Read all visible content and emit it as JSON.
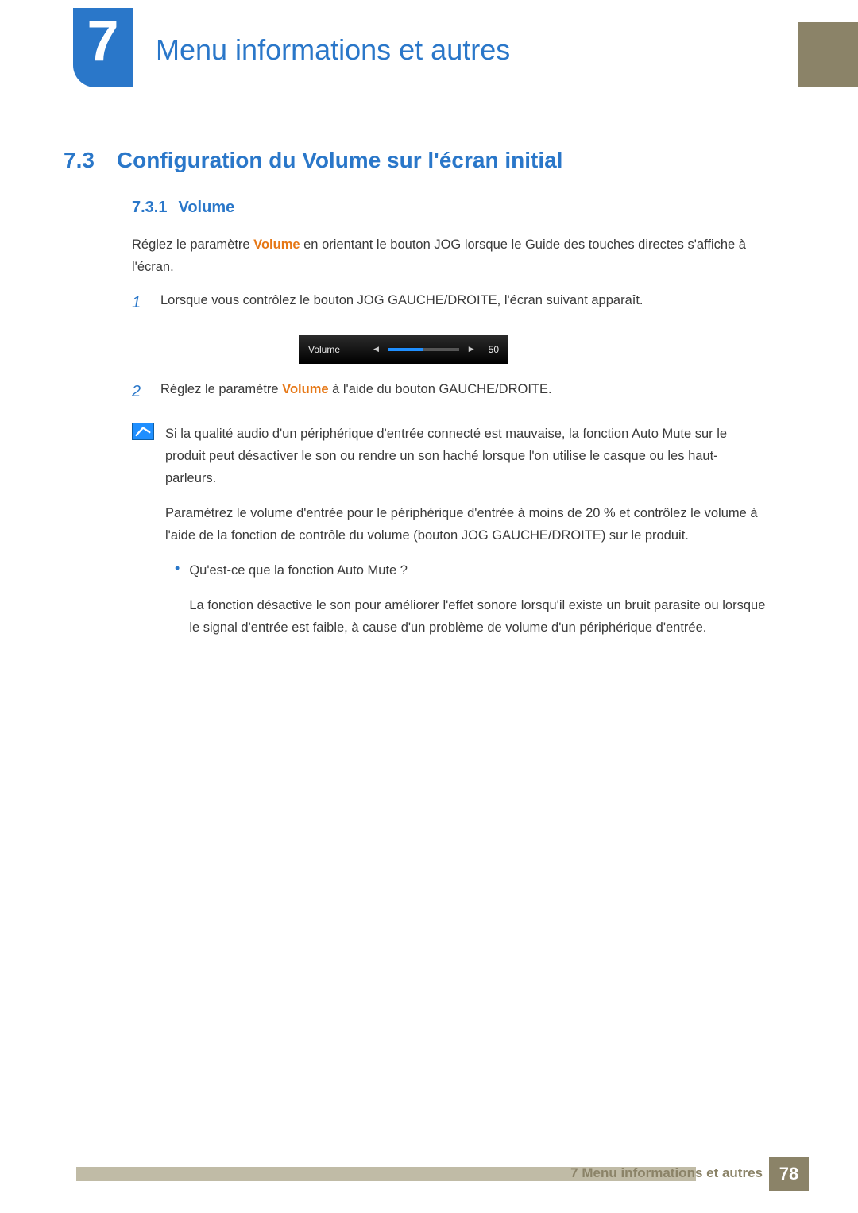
{
  "chapter": {
    "number": "7",
    "title": "Menu informations et autres"
  },
  "section": {
    "number": "7.3",
    "title": "Configuration du Volume sur l'écran initial"
  },
  "subsection": {
    "number": "7.3.1",
    "title": "Volume"
  },
  "intro": {
    "pre": "Réglez le paramètre ",
    "kw": "Volume",
    "post": " en orientant le bouton JOG lorsque le Guide des touches directes s'affiche à l'écran."
  },
  "steps": [
    {
      "n": "1",
      "text": "Lorsque vous contrôlez le bouton JOG GAUCHE/DROITE, l'écran suivant apparaît."
    },
    {
      "n": "2",
      "pre": "Réglez le paramètre ",
      "kw": "Volume",
      "post": " à l'aide du bouton GAUCHE/DROITE."
    }
  ],
  "osd": {
    "label": "Volume",
    "value": "50",
    "percent": 50
  },
  "note": {
    "p1": "Si la qualité audio d'un périphérique d'entrée connecté est mauvaise, la fonction Auto Mute sur le produit peut désactiver le son ou rendre un son haché lorsque l'on utilise le casque ou les haut-parleurs.",
    "p2": "Paramétrez le volume d'entrée pour le périphérique d'entrée à moins de 20 % et contrôlez le volume à l'aide de la fonction de contrôle du volume (bouton JOG GAUCHE/DROITE) sur le produit.",
    "bullet_q": "Qu'est-ce que la fonction Auto Mute ?",
    "bullet_a": "La fonction désactive le son pour améliorer l'effet sonore lorsqu'il existe un bruit parasite ou lorsque le signal d'entrée est faible, à cause d'un problème de volume d'un périphérique d'entrée."
  },
  "footer": {
    "label": "7 Menu informations et autres",
    "page": "78"
  }
}
